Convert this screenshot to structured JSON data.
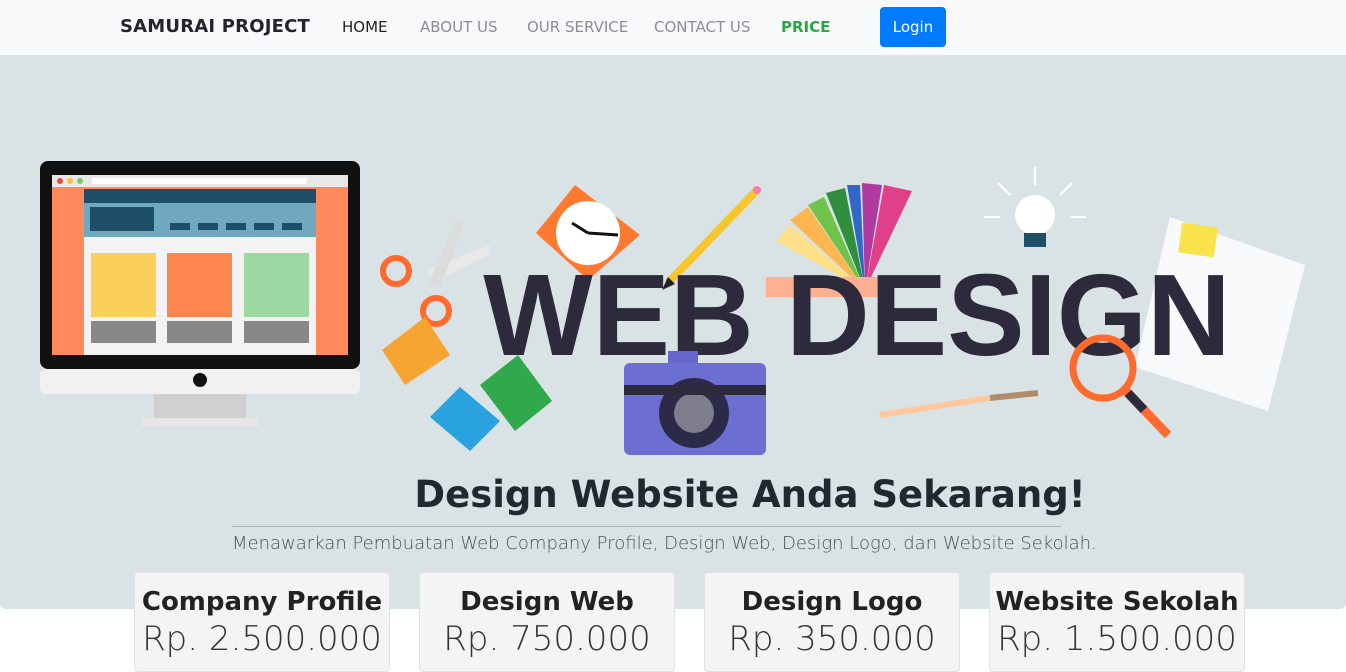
{
  "navbar": {
    "brand": "SAMURAI PROJECT",
    "links": [
      "HOME",
      "ABOUT US",
      "OUR SERVICE",
      "CONTACT US",
      "PRICE"
    ],
    "login": "Login",
    "accent": "#007bff",
    "price_color": "#28a745"
  },
  "hero": {
    "banner_text": "WEB DESIGN",
    "title": "Design Website Anda Sekarang!",
    "subtitle": "Menawarkan Pembuatan Web Company Profile, Design Web, Design Logo, dan Website Sekolah.",
    "background": "#d9e3e5"
  },
  "pricing": [
    {
      "name": "Company Profile",
      "price": "Rp. 2.500.000"
    },
    {
      "name": "Design Web",
      "price": "Rp. 750.000"
    },
    {
      "name": "Design Logo",
      "price": "Rp. 350.000"
    },
    {
      "name": "Website Sekolah",
      "price": "Rp. 1.500.000"
    }
  ]
}
